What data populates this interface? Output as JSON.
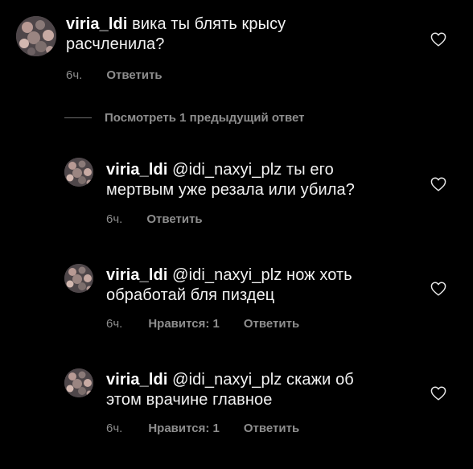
{
  "comments": [
    {
      "username": "viria_ldi",
      "text": "вика ты блять крысу",
      "text_line2": "расчленила?",
      "time": "6ч.",
      "reply": "Ответить"
    }
  ],
  "view_previous": "Посмотреть 1 предыдущий ответ",
  "replies": [
    {
      "username": "viria_ldi",
      "text_line1": "@idi_naxyi_plz ты его",
      "text_line2": "мертвым уже резала или убила?",
      "time": "6ч.",
      "reply": "Ответить"
    },
    {
      "username": "viria_ldi",
      "text_line1": "@idi_naxyi_plz нож хоть",
      "text_line2": "обработай бля пиздец",
      "time": "6ч.",
      "likes": "Нравится: 1",
      "reply": "Ответить"
    },
    {
      "username": "viria_ldi",
      "text_line1": "@idi_naxyi_plz скажи об",
      "text_line2": "этом врачине главное",
      "time": "6ч.",
      "likes": "Нравится: 1",
      "reply": "Ответить"
    }
  ],
  "icons": {
    "like": "heart-outline-icon",
    "avatar": "avatar-image"
  },
  "colors": {
    "background": "#000000",
    "text": "#f2f2f2",
    "secondary": "#8e8e8e"
  }
}
